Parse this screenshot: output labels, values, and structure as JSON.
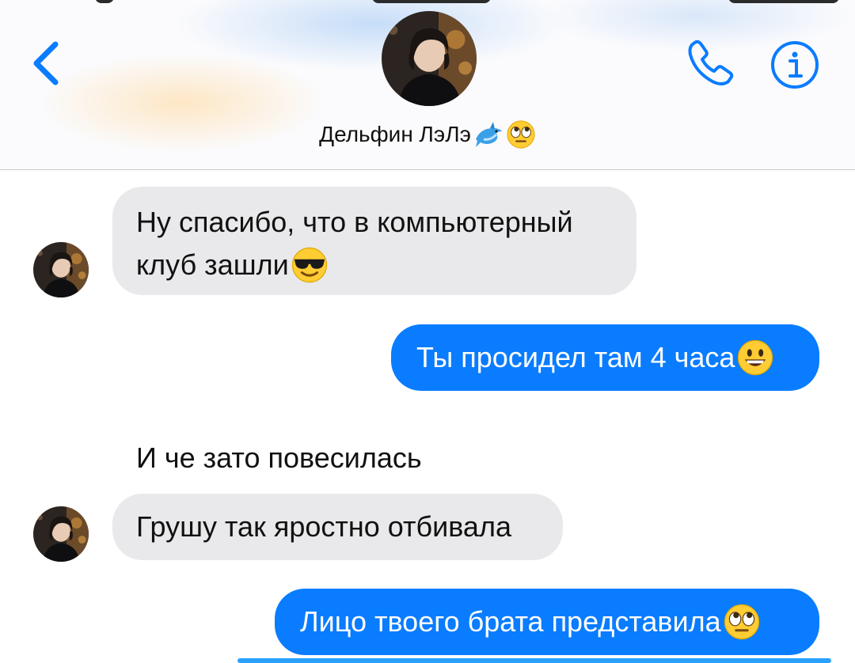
{
  "header": {
    "contact_name": "Дельфин ЛэЛэ",
    "contact_name_emojis": [
      "dolphin-emoji",
      "rolling-eyes-emoji"
    ],
    "back_icon": "chevron-left-icon",
    "call_icon": "phone-icon",
    "info_icon": "info-icon",
    "accent_color": "#0a7cff"
  },
  "messages": [
    {
      "direction": "incoming",
      "lines": [
        "Ну спасибо, что в компьютерный",
        "клуб зашли"
      ],
      "emoji": "smiling-face-with-sunglasses-emoji",
      "show_avatar": true
    },
    {
      "direction": "outgoing",
      "text": "Ты просидел там 4 часа",
      "emoji": "grinning-face-emoji"
    },
    {
      "direction": "incoming-plain",
      "text": "И че зато повесилась"
    },
    {
      "direction": "incoming",
      "text": "Грушу так яростно отбивала",
      "show_avatar": true
    },
    {
      "direction": "outgoing",
      "text": "Лицо твоего брата представила",
      "emoji": "rolling-eyes-emoji"
    }
  ],
  "colors": {
    "incoming_bubble": "#e9e9eb",
    "outgoing_bubble": "#0a7cff",
    "outgoing_text": "#ffffff"
  }
}
